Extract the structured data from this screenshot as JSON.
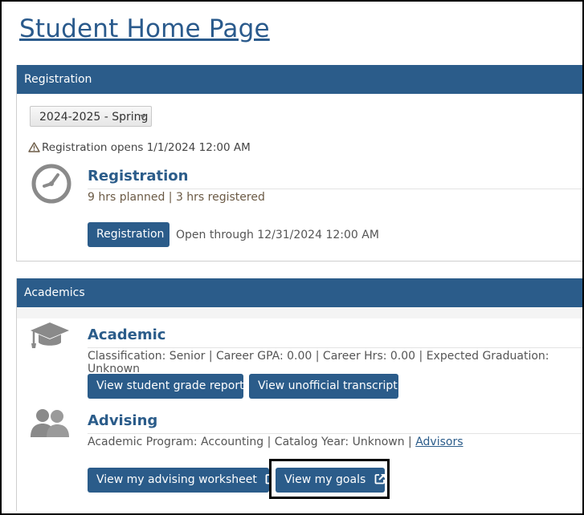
{
  "page": {
    "title": "Student Home Page"
  },
  "registration": {
    "header": "Registration",
    "term_select": {
      "value": "2024-2025 - Spring"
    },
    "notice": "Registration opens 1/1/2024 12:00 AM",
    "section_title": "Registration",
    "hours_summary": "9 hrs planned | 3 hrs registered",
    "button_label": "Registration",
    "open_through": "Open through 12/31/2024 12:00 AM",
    "icons": {
      "notice": "warning-icon",
      "section": "clock-icon"
    }
  },
  "academics": {
    "header": "Academics",
    "academic": {
      "title": "Academic",
      "details": "Classification: Senior | Career GPA: 0.00 | Career Hrs: 0.00 | Expected Graduation: Unknown",
      "buttons": {
        "grade_report": "View student grade report",
        "unofficial_transcript": "View unofficial transcript"
      },
      "icon": "graduation-cap-icon"
    },
    "advising": {
      "title": "Advising",
      "details": "Academic Program: Accounting | Catalog Year: Unknown |",
      "advisors_link": "Advisors",
      "buttons": {
        "advising_worksheet": "View my advising worksheet",
        "goals": "View my goals"
      },
      "icon": "users-icon"
    }
  },
  "colors": {
    "primary": "#2b5c8a",
    "title": "#2a5a8c"
  }
}
